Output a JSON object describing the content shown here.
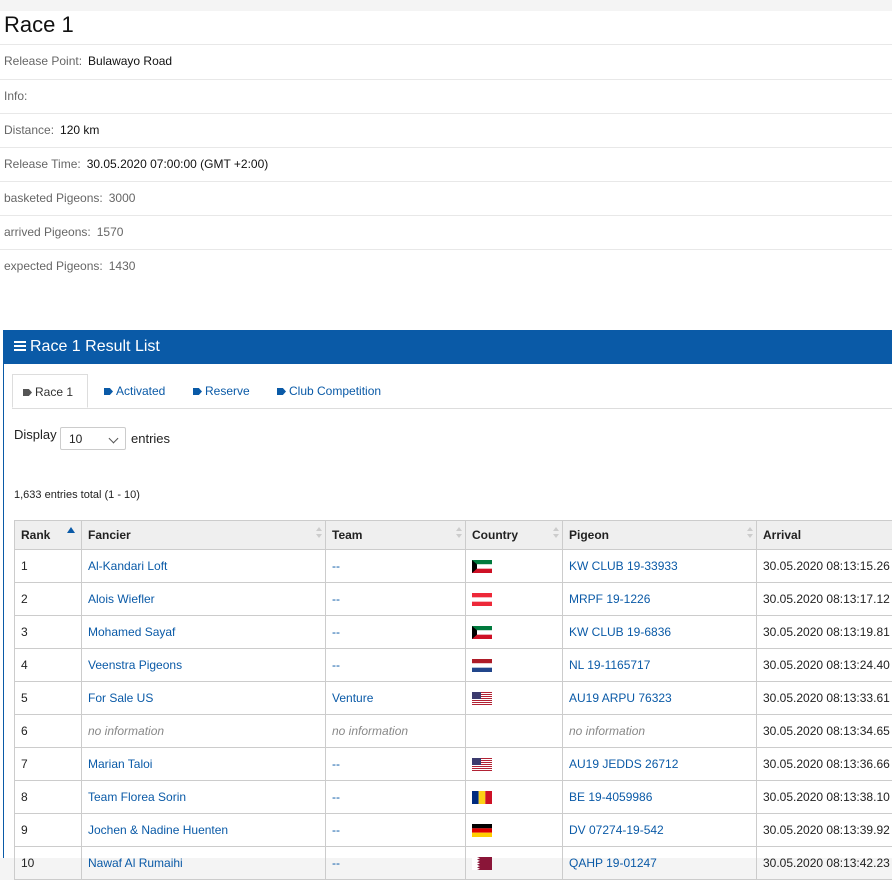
{
  "page": {
    "title": "Race 1",
    "info": [
      {
        "label": "Release Point:",
        "value": "Bulawayo Road"
      },
      {
        "label": "Info:",
        "value": ""
      },
      {
        "label": "Distance:",
        "value": "120 km"
      },
      {
        "label": "Release Time:",
        "value": "30.05.2020 07:00:00 (GMT +2:00)"
      },
      {
        "label": "basketed Pigeons:",
        "value": "3000"
      },
      {
        "label": "arrived Pigeons:",
        "value": "1570"
      },
      {
        "label": "expected Pigeons:",
        "value": "1430"
      }
    ]
  },
  "panel": {
    "title": "Race 1 Result List",
    "tabs": [
      "Race 1",
      "Activated",
      "Reserve",
      "Club Competition"
    ],
    "display_label": "Display",
    "display_value": "10",
    "entries_label": "entries",
    "total_text": "1,633 entries total (1 - 10)",
    "colors": {
      "header": "#0a5aa7",
      "link": "#0a5aa7"
    }
  },
  "table": {
    "headers": [
      "Rank",
      "Fancier",
      "Team",
      "Country",
      "Pigeon",
      "Arrival"
    ],
    "rows": [
      {
        "rank": "1",
        "fancier": "Al-Kandari Loft",
        "team": "--",
        "flag": "kuwait-flag",
        "pigeon": "KW CLUB 19-33933",
        "arrival": "30.05.2020 08:13:15.26"
      },
      {
        "rank": "2",
        "fancier": "Alois Wiefler",
        "team": "--",
        "flag": "austria-flag",
        "pigeon": "MRPF 19-1226",
        "arrival": "30.05.2020 08:13:17.12"
      },
      {
        "rank": "3",
        "fancier": "Mohamed Sayaf",
        "team": "--",
        "flag": "kuwait-flag",
        "pigeon": "KW CLUB 19-6836",
        "arrival": "30.05.2020 08:13:19.81"
      },
      {
        "rank": "4",
        "fancier": "Veenstra Pigeons",
        "team": "--",
        "flag": "netherlands-flag",
        "pigeon": "NL 19-1165717",
        "arrival": "30.05.2020 08:13:24.40"
      },
      {
        "rank": "5",
        "fancier": "For Sale US",
        "team": "Venture",
        "flag": "usa-flag",
        "pigeon": "AU19 ARPU 76323",
        "arrival": "30.05.2020 08:13:33.61"
      },
      {
        "rank": "6",
        "fancier": "no information",
        "team": "no information",
        "flag": "",
        "pigeon": "no information",
        "arrival": "30.05.2020 08:13:34.65"
      },
      {
        "rank": "7",
        "fancier": "Marian Taloi",
        "team": "--",
        "flag": "usa-flag",
        "pigeon": "AU19 JEDDS 26712",
        "arrival": "30.05.2020 08:13:36.66"
      },
      {
        "rank": "8",
        "fancier": "Team Florea Sorin",
        "team": "--",
        "flag": "romania-flag",
        "pigeon": "BE 19-4059986",
        "arrival": "30.05.2020 08:13:38.10"
      },
      {
        "rank": "9",
        "fancier": "Jochen & Nadine Huenten",
        "team": "--",
        "flag": "germany-flag",
        "pigeon": "DV 07274-19-542",
        "arrival": "30.05.2020 08:13:39.92"
      },
      {
        "rank": "10",
        "fancier": "Nawaf Al Rumaihi",
        "team": "--",
        "flag": "qatar-flag",
        "pigeon": "QAHP 19-01247",
        "arrival": "30.05.2020 08:13:42.23"
      }
    ]
  }
}
